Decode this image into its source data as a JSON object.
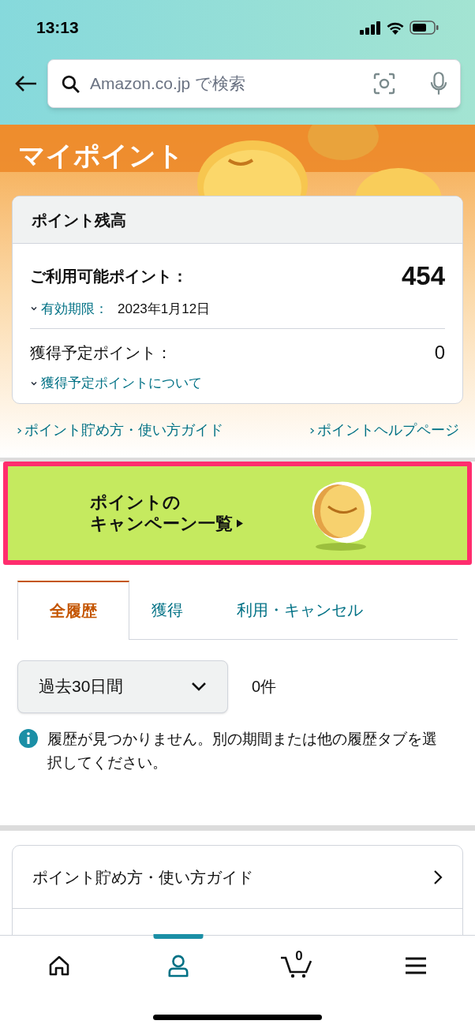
{
  "status_bar": {
    "time": "13:13"
  },
  "search": {
    "placeholder": "Amazon.co.jp で検索"
  },
  "header": {
    "title": "マイポイント"
  },
  "balance_card": {
    "title": "ポイント残高",
    "available_label": "ご利用可能ポイント：",
    "available_value": "454",
    "expiry_label": "有効期限：",
    "expiry_date": "2023年1月12日",
    "pending_label": "獲得予定ポイント：",
    "pending_value": "0",
    "pending_link": "獲得予定ポイントについて"
  },
  "links": [
    "ポイント貯め方・使い方ガイド",
    "ポイントヘルプページ"
  ],
  "banner": {
    "lines": [
      "ポイントの",
      "キャンペーン一覧"
    ]
  },
  "tabs": [
    {
      "label": "全履歴",
      "selected": true
    },
    {
      "label": "獲得",
      "selected": false
    },
    {
      "label": "利用・キャンセル",
      "selected": false
    }
  ],
  "period": {
    "value": "過去30日間",
    "count": "0件"
  },
  "info": "履歴が見つかりません。別の期間または他の履歴タブを選択してください。",
  "menu_items": [
    "ポイント貯め方・使い方ガイド"
  ],
  "nav": [
    {
      "kind": "home",
      "selected": false
    },
    {
      "kind": "account",
      "selected": true
    },
    {
      "kind": "cart",
      "selected": false,
      "count": "0"
    },
    {
      "kind": "menu",
      "selected": false
    }
  ]
}
